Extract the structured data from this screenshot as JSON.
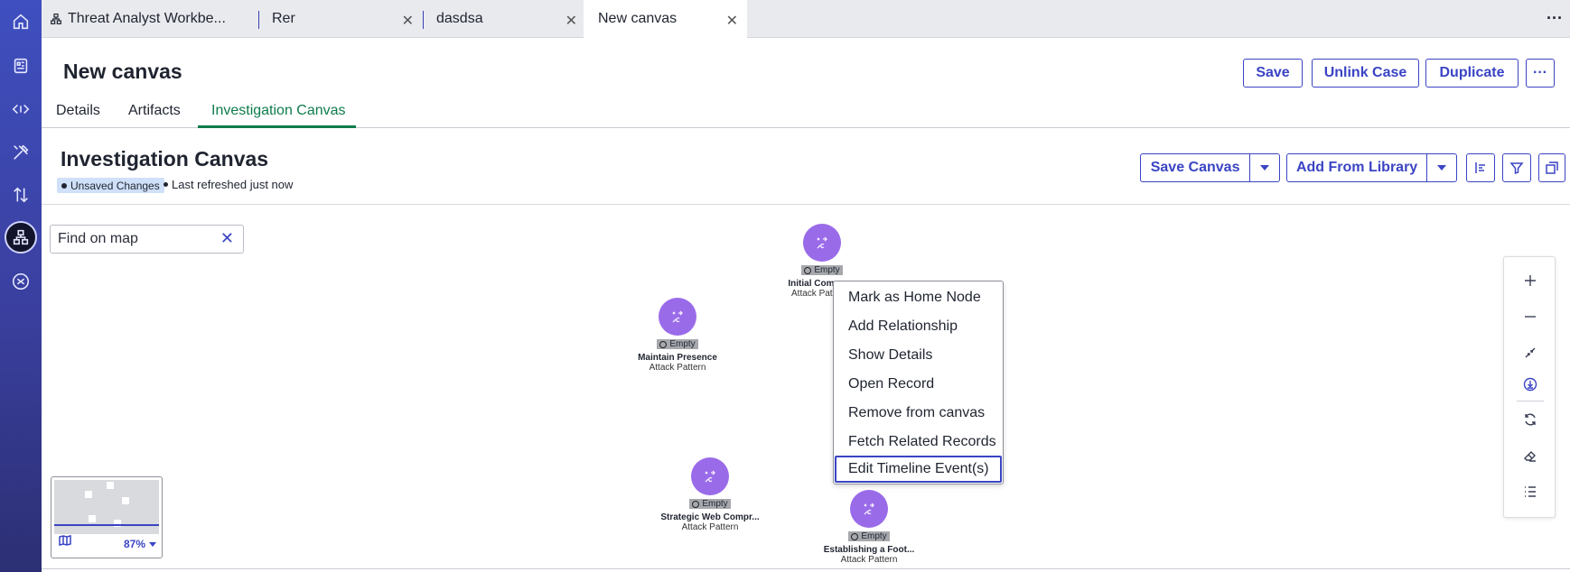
{
  "tabs": [
    {
      "label": "Threat Analyst Workbe...",
      "icon": "hierarchy-icon",
      "closable": false
    },
    {
      "label": "Rer",
      "closable": true
    },
    {
      "label": "dasdsa",
      "closable": true
    },
    {
      "label": "New canvas",
      "closable": true,
      "active": true
    }
  ],
  "tab_more": "···",
  "page": {
    "title": "New canvas"
  },
  "actions": {
    "save": "Save",
    "unlink": "Unlink Case",
    "duplicate": "Duplicate",
    "more": "···"
  },
  "subtabs": [
    "Details",
    "Artifacts",
    "Investigation Canvas"
  ],
  "active_subtab": "Investigation Canvas",
  "canvas": {
    "title": "Investigation Canvas",
    "badge": "Unsaved Changes",
    "refreshed": "Last refreshed just now",
    "save_canvas": "Save Canvas",
    "add_from_library": "Add From Library"
  },
  "search": {
    "value": "Find on map"
  },
  "nodes": [
    {
      "status": "Empty",
      "name": "Initial Comp",
      "type": "Attack Pat"
    },
    {
      "status": "Empty",
      "name": "Maintain Presence",
      "type": "Attack Pattern"
    },
    {
      "status": "Empty",
      "name": "Strategic Web Compr...",
      "type": "Attack Pattern"
    },
    {
      "status": "Empty",
      "name": "Establishing a Foot...",
      "type": "Attack Pattern"
    }
  ],
  "context_menu": [
    "Mark as Home Node",
    "Add Relationship",
    "Show Details",
    "Open Record",
    "Remove from canvas",
    "Fetch Related Records",
    "Edit Timeline Event(s)"
  ],
  "focused_menu_item": "Edit Timeline Event(s)",
  "minimap": {
    "zoom": "87%"
  },
  "colors": {
    "accent": "#3a44c4",
    "node": "#9a6be9",
    "subtab_active": "#0d7c4b",
    "nav": "#3f4fbf"
  }
}
